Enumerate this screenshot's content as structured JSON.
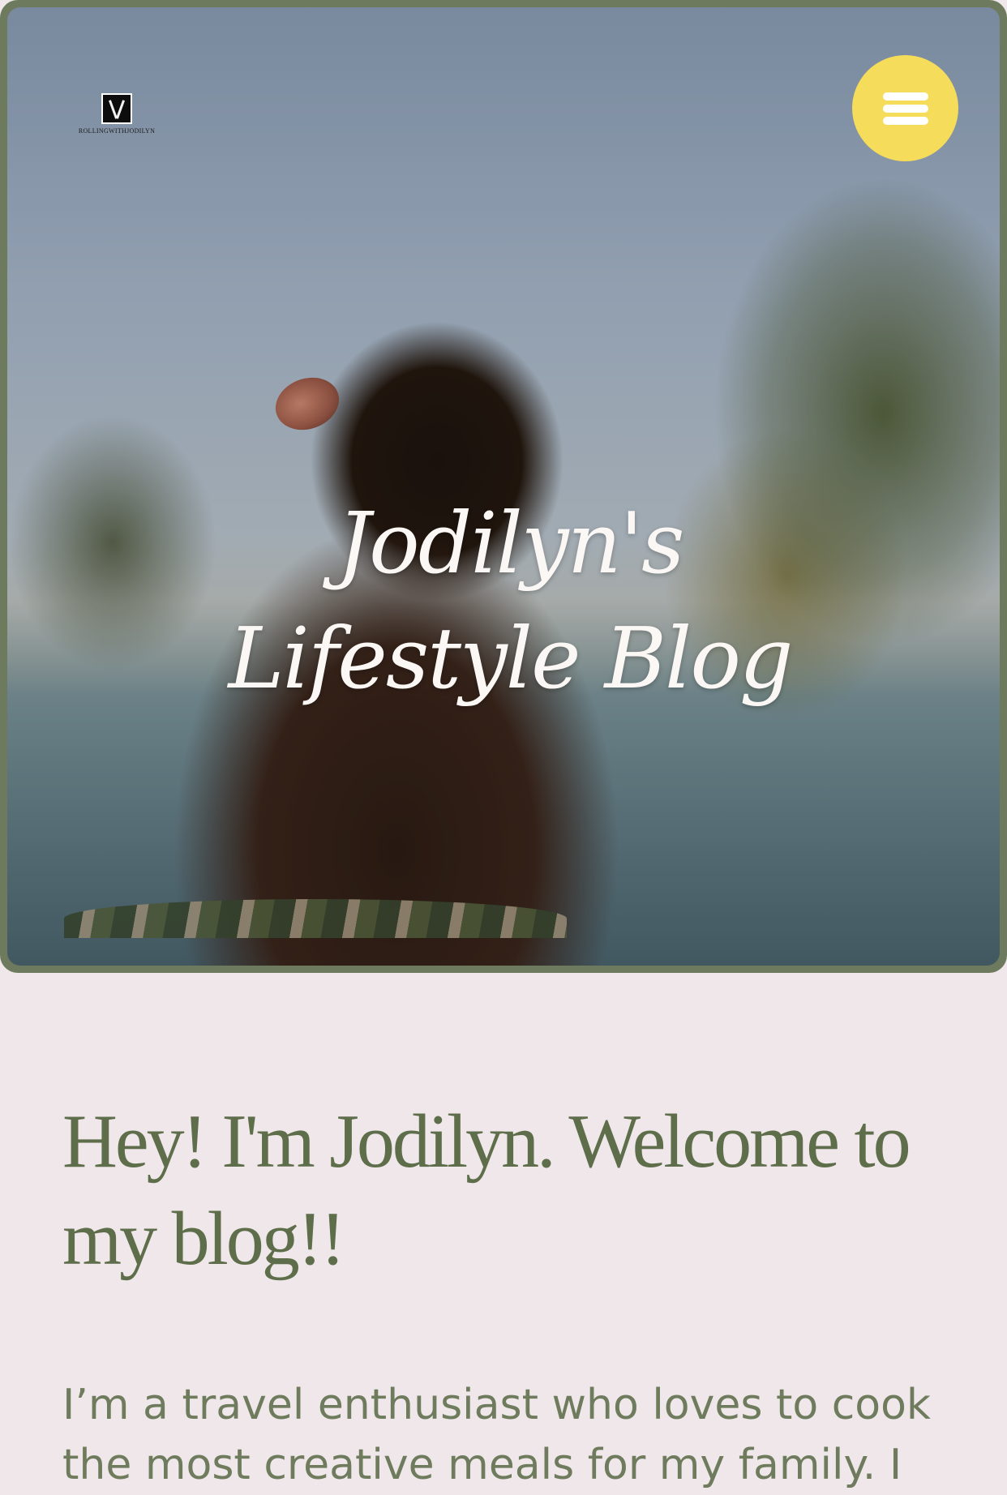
{
  "header": {
    "logo_text": "ROLLINGWITHJODILYN",
    "logo_icon": "x-monogram-logo",
    "menu_icon": "hamburger-menu-icon"
  },
  "hero": {
    "title": "Jodilyn's Lifestyle Blog"
  },
  "intro": {
    "heading": "Hey! I'm Jodilyn. Welcome to my blog!!",
    "body": " I’m a travel enthusiast who loves to cook the most creative meals for my family. I"
  },
  "colors": {
    "frame": "#6e7a5e",
    "menu_button": "#f5dc5a",
    "page_background": "#efe7ea",
    "heading": "#5f6e4a",
    "body_text": "#6f7b5d",
    "hero_title": "#fbf7f4"
  }
}
